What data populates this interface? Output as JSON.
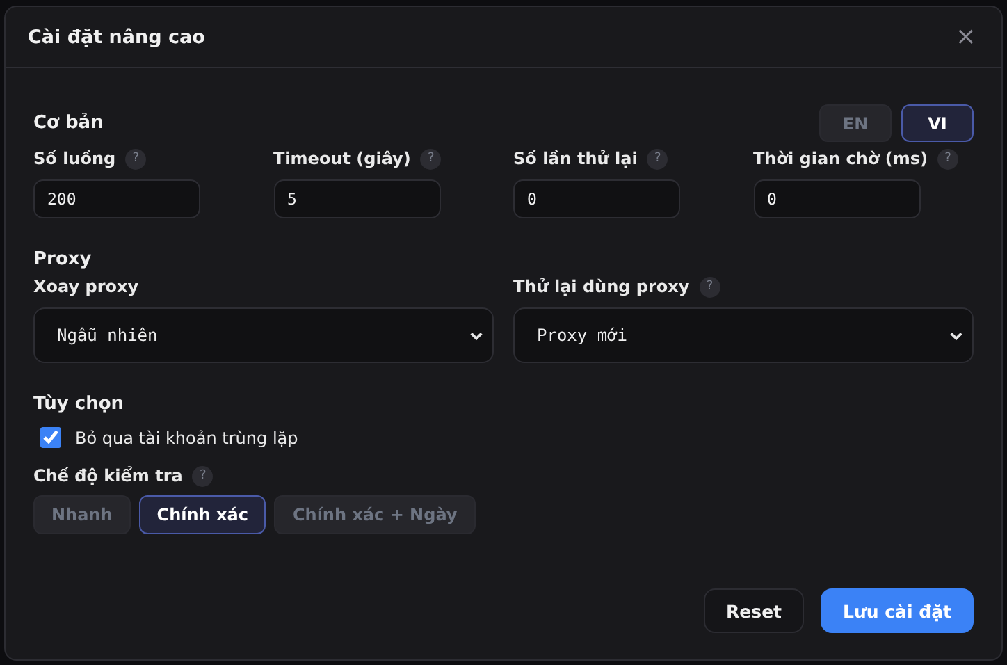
{
  "dialog": {
    "title": "Cài đặt nâng cao",
    "close": "×"
  },
  "basic": {
    "title": "Cơ bản",
    "languages": [
      {
        "label": "EN",
        "selected": false
      },
      {
        "label": "VI",
        "selected": true
      }
    ],
    "fields": [
      {
        "label": "Số luồng",
        "help": "?",
        "value": "200"
      },
      {
        "label": "Timeout (giây)",
        "help": "?",
        "value": "5"
      },
      {
        "label": "Số lần thử lại",
        "help": "?",
        "value": "0"
      },
      {
        "label": "Thời gian chờ (ms)",
        "help": "?",
        "value": "0"
      }
    ]
  },
  "proxy": {
    "title": "Proxy",
    "selects": [
      {
        "label": "Xoay proxy",
        "value": "Ngẫu nhiên"
      },
      {
        "label": "Thử lại dùng proxy",
        "help": "?",
        "value": "Proxy mới"
      }
    ]
  },
  "options": {
    "title": "Tùy chọn",
    "checkbox": {
      "label": "Bỏ qua tài khoản trùng lặp",
      "checked": true
    },
    "mode": {
      "label": "Chế độ kiểm tra",
      "help": "?",
      "choices": [
        {
          "label": "Nhanh",
          "selected": false
        },
        {
          "label": "Chính xác",
          "selected": true
        },
        {
          "label": "Chính xác + Ngày",
          "selected": false
        }
      ]
    }
  },
  "buttons": [
    {
      "label": "Reset",
      "kind": "secondary"
    },
    {
      "label": "Lưu cài đặt",
      "kind": "primary"
    }
  ]
}
